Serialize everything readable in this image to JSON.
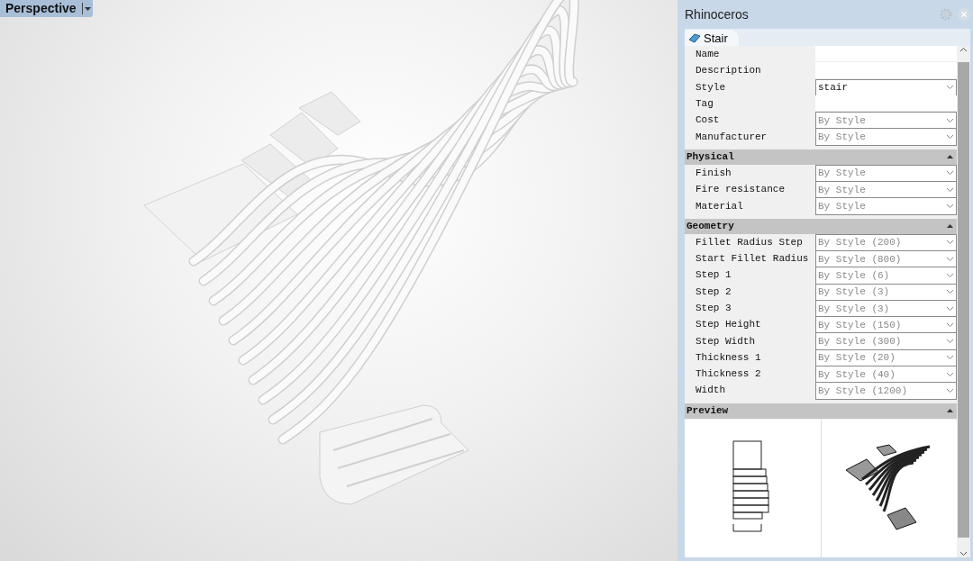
{
  "viewport": {
    "title": "Perspective"
  },
  "panel": {
    "title": "Rhinoceros",
    "tab": {
      "label": "Stair",
      "selected": true
    },
    "general": [
      {
        "label": "Name",
        "kind": "field"
      },
      {
        "label": "Description",
        "kind": "field"
      },
      {
        "label": "Style",
        "kind": "dropdown",
        "value": "stair",
        "inherited": false
      },
      {
        "label": "Tag",
        "kind": "field"
      },
      {
        "label": "Cost",
        "kind": "dropdown",
        "value": "By Style",
        "inherited": true
      },
      {
        "label": "Manufacturer",
        "kind": "dropdown",
        "value": "By Style",
        "inherited": true
      }
    ],
    "sections": [
      {
        "title": "Physical",
        "expanded": true,
        "kind": "rows",
        "rows": [
          {
            "label": "Finish",
            "kind": "dropdown",
            "value": "By Style",
            "inherited": true
          },
          {
            "label": "Fire resistance",
            "kind": "dropdown",
            "value": "By Style",
            "inherited": true
          },
          {
            "label": "Material",
            "kind": "dropdown",
            "value": "By Style",
            "inherited": true
          }
        ]
      },
      {
        "title": "Geometry",
        "expanded": true,
        "kind": "rows",
        "rows": [
          {
            "label": "Fillet Radius Step",
            "kind": "dropdown",
            "value": "By Style (200)",
            "inherited": true
          },
          {
            "label": "Start Fillet Radius",
            "kind": "dropdown",
            "value": "By Style (800)",
            "inherited": true
          },
          {
            "label": "Step 1",
            "kind": "dropdown",
            "value": "By Style (6)",
            "inherited": true
          },
          {
            "label": "Step 2",
            "kind": "dropdown",
            "value": "By Style (3)",
            "inherited": true
          },
          {
            "label": "Step 3",
            "kind": "dropdown",
            "value": "By Style (3)",
            "inherited": true
          },
          {
            "label": "Step Height",
            "kind": "dropdown",
            "value": "By Style (150)",
            "inherited": true
          },
          {
            "label": "Step Width",
            "kind": "dropdown",
            "value": "By Style (300)",
            "inherited": true
          },
          {
            "label": "Thickness 1",
            "kind": "dropdown",
            "value": "By Style (20)",
            "inherited": true
          },
          {
            "label": "Thickness 2",
            "kind": "dropdown",
            "value": "By Style (40)",
            "inherited": true
          },
          {
            "label": "Width",
            "kind": "dropdown",
            "value": "By Style (1200)",
            "inherited": true
          }
        ]
      },
      {
        "title": "Preview",
        "expanded": true,
        "kind": "preview"
      }
    ]
  }
}
